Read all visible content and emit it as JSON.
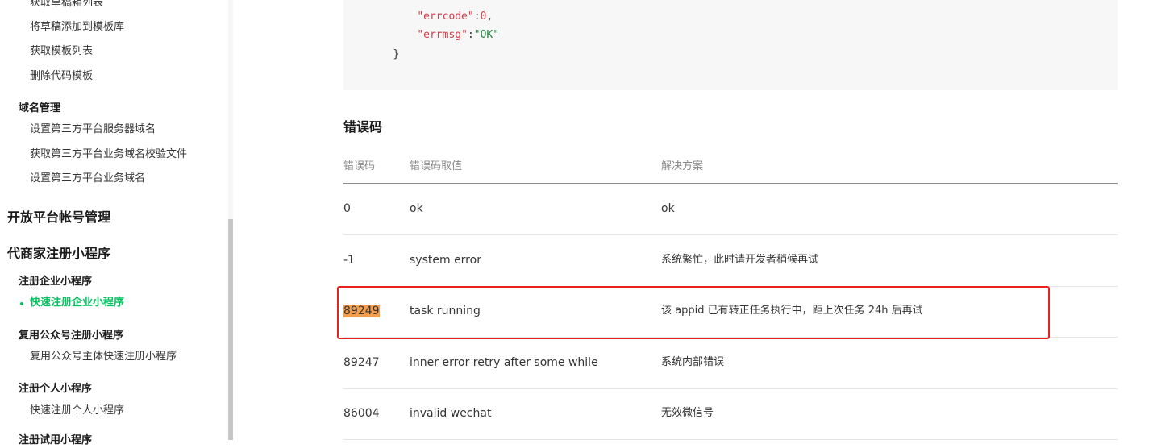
{
  "sidebar": {
    "items_top": [
      "获取草稿箱列表",
      "将草稿添加到模板库",
      "获取模板列表",
      "删除代码模板"
    ],
    "domain_group": "域名管理",
    "domain_items": [
      "设置第三方平台服务器域名",
      "获取第三方平台业务域名校验文件",
      "设置第三方平台业务域名"
    ],
    "section_account": "开放平台帐号管理",
    "section_register": "代商家注册小程序",
    "group_enterprise": "注册企业小程序",
    "item_enterprise_fast": "快速注册企业小程序",
    "group_reuse": "复用公众号注册小程序",
    "item_reuse": "复用公众号主体快速注册小程序",
    "group_personal": "注册个人小程序",
    "item_personal": "快速注册个人小程序",
    "group_trial": "注册试用小程序"
  },
  "code": {
    "errcode_key": "\"errcode\"",
    "errcode_val": "0",
    "errmsg_key": "\"errmsg\"",
    "errmsg_val": "\"OK\"",
    "close_brace": "}"
  },
  "error_section": {
    "title": "错误码",
    "headers": [
      "错误码",
      "错误码取值",
      "解决方案"
    ],
    "rows": [
      {
        "code": "0",
        "value": "ok",
        "solution": "ok"
      },
      {
        "code": "-1",
        "value": "system error",
        "solution": "系统繁忙，此时请开发者稍候再试"
      },
      {
        "code": "89249",
        "value": "task running",
        "solution": "该 appid 已有转正任务执行中，距上次任务 24h 后再试"
      },
      {
        "code": "89247",
        "value": "inner error  retry after some while",
        "solution": "系统内部错误"
      },
      {
        "code": "86004",
        "value": "invalid wechat",
        "solution": "无效微信号"
      }
    ]
  },
  "colors": {
    "accent_green": "#07c160",
    "highlight": "#f29e4c",
    "annotation_red": "#e8231f"
  }
}
